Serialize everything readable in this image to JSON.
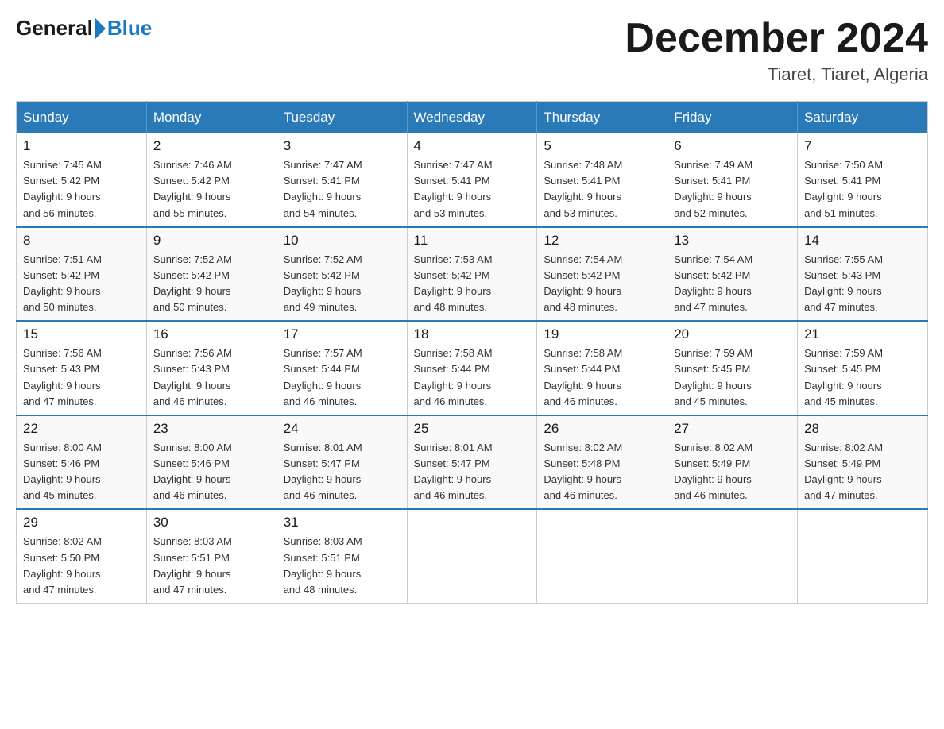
{
  "header": {
    "logo_general": "General",
    "logo_blue": "Blue",
    "month_title": "December 2024",
    "location": "Tiaret, Tiaret, Algeria"
  },
  "days_of_week": [
    "Sunday",
    "Monday",
    "Tuesday",
    "Wednesday",
    "Thursday",
    "Friday",
    "Saturday"
  ],
  "weeks": [
    [
      {
        "day": "1",
        "sunrise": "Sunrise: 7:45 AM",
        "sunset": "Sunset: 5:42 PM",
        "daylight": "Daylight: 9 hours",
        "daylight2": "and 56 minutes."
      },
      {
        "day": "2",
        "sunrise": "Sunrise: 7:46 AM",
        "sunset": "Sunset: 5:42 PM",
        "daylight": "Daylight: 9 hours",
        "daylight2": "and 55 minutes."
      },
      {
        "day": "3",
        "sunrise": "Sunrise: 7:47 AM",
        "sunset": "Sunset: 5:41 PM",
        "daylight": "Daylight: 9 hours",
        "daylight2": "and 54 minutes."
      },
      {
        "day": "4",
        "sunrise": "Sunrise: 7:47 AM",
        "sunset": "Sunset: 5:41 PM",
        "daylight": "Daylight: 9 hours",
        "daylight2": "and 53 minutes."
      },
      {
        "day": "5",
        "sunrise": "Sunrise: 7:48 AM",
        "sunset": "Sunset: 5:41 PM",
        "daylight": "Daylight: 9 hours",
        "daylight2": "and 53 minutes."
      },
      {
        "day": "6",
        "sunrise": "Sunrise: 7:49 AM",
        "sunset": "Sunset: 5:41 PM",
        "daylight": "Daylight: 9 hours",
        "daylight2": "and 52 minutes."
      },
      {
        "day": "7",
        "sunrise": "Sunrise: 7:50 AM",
        "sunset": "Sunset: 5:41 PM",
        "daylight": "Daylight: 9 hours",
        "daylight2": "and 51 minutes."
      }
    ],
    [
      {
        "day": "8",
        "sunrise": "Sunrise: 7:51 AM",
        "sunset": "Sunset: 5:42 PM",
        "daylight": "Daylight: 9 hours",
        "daylight2": "and 50 minutes."
      },
      {
        "day": "9",
        "sunrise": "Sunrise: 7:52 AM",
        "sunset": "Sunset: 5:42 PM",
        "daylight": "Daylight: 9 hours",
        "daylight2": "and 50 minutes."
      },
      {
        "day": "10",
        "sunrise": "Sunrise: 7:52 AM",
        "sunset": "Sunset: 5:42 PM",
        "daylight": "Daylight: 9 hours",
        "daylight2": "and 49 minutes."
      },
      {
        "day": "11",
        "sunrise": "Sunrise: 7:53 AM",
        "sunset": "Sunset: 5:42 PM",
        "daylight": "Daylight: 9 hours",
        "daylight2": "and 48 minutes."
      },
      {
        "day": "12",
        "sunrise": "Sunrise: 7:54 AM",
        "sunset": "Sunset: 5:42 PM",
        "daylight": "Daylight: 9 hours",
        "daylight2": "and 48 minutes."
      },
      {
        "day": "13",
        "sunrise": "Sunrise: 7:54 AM",
        "sunset": "Sunset: 5:42 PM",
        "daylight": "Daylight: 9 hours",
        "daylight2": "and 47 minutes."
      },
      {
        "day": "14",
        "sunrise": "Sunrise: 7:55 AM",
        "sunset": "Sunset: 5:43 PM",
        "daylight": "Daylight: 9 hours",
        "daylight2": "and 47 minutes."
      }
    ],
    [
      {
        "day": "15",
        "sunrise": "Sunrise: 7:56 AM",
        "sunset": "Sunset: 5:43 PM",
        "daylight": "Daylight: 9 hours",
        "daylight2": "and 47 minutes."
      },
      {
        "day": "16",
        "sunrise": "Sunrise: 7:56 AM",
        "sunset": "Sunset: 5:43 PM",
        "daylight": "Daylight: 9 hours",
        "daylight2": "and 46 minutes."
      },
      {
        "day": "17",
        "sunrise": "Sunrise: 7:57 AM",
        "sunset": "Sunset: 5:44 PM",
        "daylight": "Daylight: 9 hours",
        "daylight2": "and 46 minutes."
      },
      {
        "day": "18",
        "sunrise": "Sunrise: 7:58 AM",
        "sunset": "Sunset: 5:44 PM",
        "daylight": "Daylight: 9 hours",
        "daylight2": "and 46 minutes."
      },
      {
        "day": "19",
        "sunrise": "Sunrise: 7:58 AM",
        "sunset": "Sunset: 5:44 PM",
        "daylight": "Daylight: 9 hours",
        "daylight2": "and 46 minutes."
      },
      {
        "day": "20",
        "sunrise": "Sunrise: 7:59 AM",
        "sunset": "Sunset: 5:45 PM",
        "daylight": "Daylight: 9 hours",
        "daylight2": "and 45 minutes."
      },
      {
        "day": "21",
        "sunrise": "Sunrise: 7:59 AM",
        "sunset": "Sunset: 5:45 PM",
        "daylight": "Daylight: 9 hours",
        "daylight2": "and 45 minutes."
      }
    ],
    [
      {
        "day": "22",
        "sunrise": "Sunrise: 8:00 AM",
        "sunset": "Sunset: 5:46 PM",
        "daylight": "Daylight: 9 hours",
        "daylight2": "and 45 minutes."
      },
      {
        "day": "23",
        "sunrise": "Sunrise: 8:00 AM",
        "sunset": "Sunset: 5:46 PM",
        "daylight": "Daylight: 9 hours",
        "daylight2": "and 46 minutes."
      },
      {
        "day": "24",
        "sunrise": "Sunrise: 8:01 AM",
        "sunset": "Sunset: 5:47 PM",
        "daylight": "Daylight: 9 hours",
        "daylight2": "and 46 minutes."
      },
      {
        "day": "25",
        "sunrise": "Sunrise: 8:01 AM",
        "sunset": "Sunset: 5:47 PM",
        "daylight": "Daylight: 9 hours",
        "daylight2": "and 46 minutes."
      },
      {
        "day": "26",
        "sunrise": "Sunrise: 8:02 AM",
        "sunset": "Sunset: 5:48 PM",
        "daylight": "Daylight: 9 hours",
        "daylight2": "and 46 minutes."
      },
      {
        "day": "27",
        "sunrise": "Sunrise: 8:02 AM",
        "sunset": "Sunset: 5:49 PM",
        "daylight": "Daylight: 9 hours",
        "daylight2": "and 46 minutes."
      },
      {
        "day": "28",
        "sunrise": "Sunrise: 8:02 AM",
        "sunset": "Sunset: 5:49 PM",
        "daylight": "Daylight: 9 hours",
        "daylight2": "and 47 minutes."
      }
    ],
    [
      {
        "day": "29",
        "sunrise": "Sunrise: 8:02 AM",
        "sunset": "Sunset: 5:50 PM",
        "daylight": "Daylight: 9 hours",
        "daylight2": "and 47 minutes."
      },
      {
        "day": "30",
        "sunrise": "Sunrise: 8:03 AM",
        "sunset": "Sunset: 5:51 PM",
        "daylight": "Daylight: 9 hours",
        "daylight2": "and 47 minutes."
      },
      {
        "day": "31",
        "sunrise": "Sunrise: 8:03 AM",
        "sunset": "Sunset: 5:51 PM",
        "daylight": "Daylight: 9 hours",
        "daylight2": "and 48 minutes."
      },
      null,
      null,
      null,
      null
    ]
  ]
}
